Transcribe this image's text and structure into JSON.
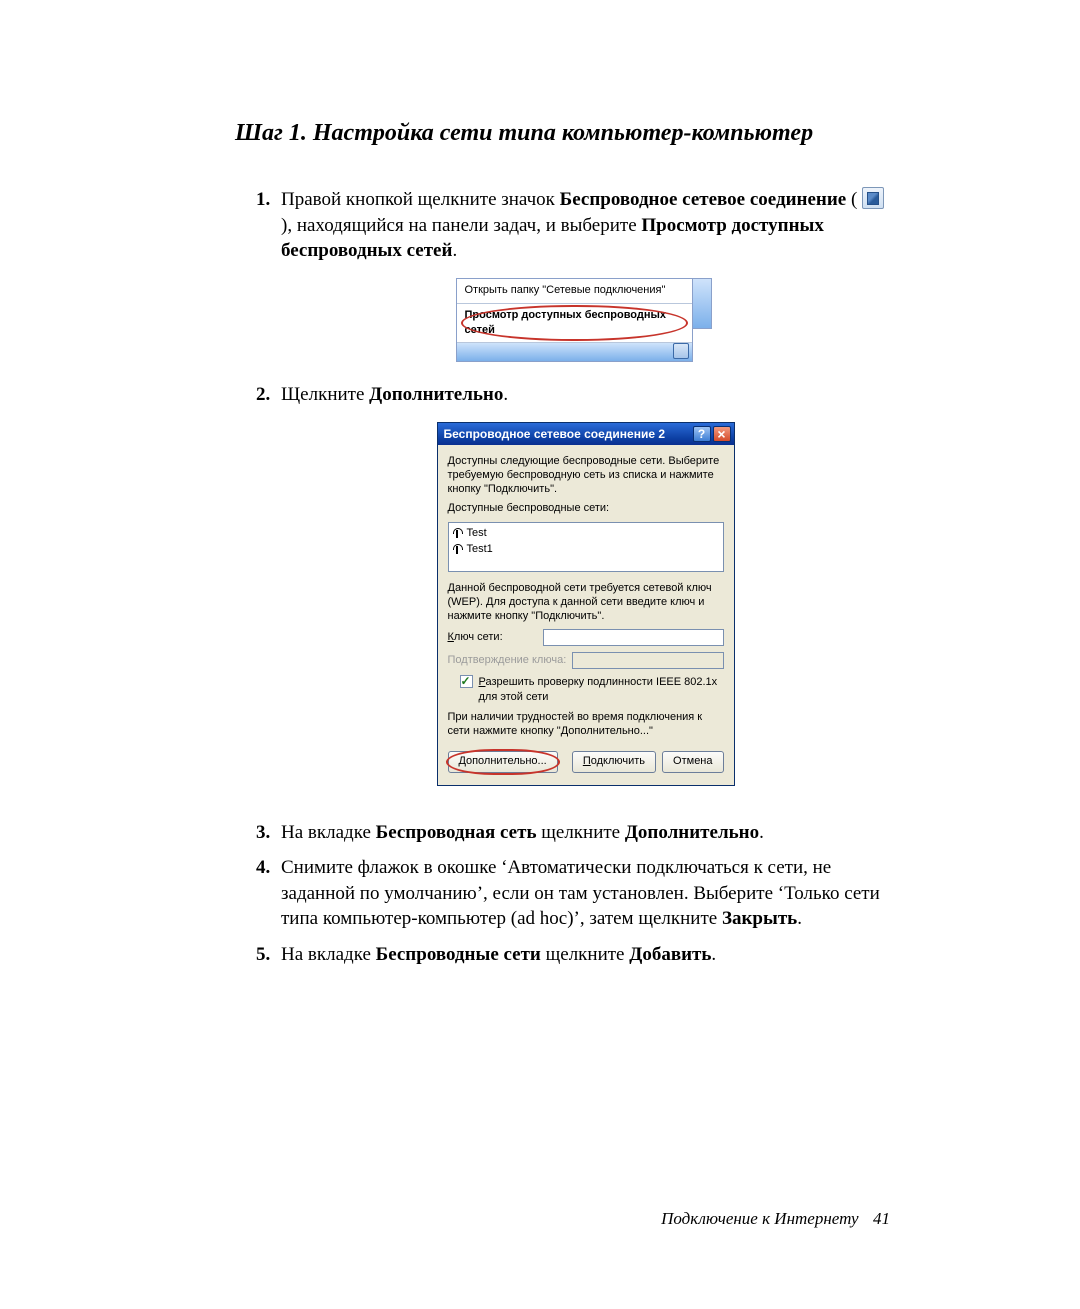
{
  "step_title": "Шаг 1. Настройка сети типа компьютер-компьютер",
  "steps": {
    "s1": {
      "pre": "Правой кнопкой щелкните значок ",
      "b1": "Беспроводное сетевое соединение",
      "mid": " ( ",
      "post_icon": " ), находящийся на панели задач, и выберите ",
      "b2": "Просмотр доступных беспроводных сетей",
      "tail": "."
    },
    "s2": {
      "pre": "Щелкните ",
      "b1": "Дополнительно",
      "tail": "."
    },
    "s3": {
      "pre": "На вкладке ",
      "b1": "Беспроводная сеть",
      "mid": " щелкните ",
      "b2": "Дополнительно",
      "tail": "."
    },
    "s4": {
      "pre": "Снимите флажок в окошке ‘Автоматически подключаться к сети, не заданной по умолчанию’, если он там установлен. Выберите ‘Только сети типа компьютер-компьютер (ad hoc)’, затем щелкните ",
      "b1": "Закрыть",
      "tail": "."
    },
    "s5": {
      "pre": "На вкладке ",
      "b1": "Беспроводные сети",
      "mid": " щелкните ",
      "b2": "Добавить",
      "tail": "."
    }
  },
  "context_menu": {
    "item1": "Открыть папку \"Сетевые подключения\"",
    "item2": "Просмотр доступных беспроводных сетей"
  },
  "dialog": {
    "title": "Беспроводное сетевое соединение 2",
    "intro": "Доступны следующие беспроводные сети. Выберите требуемую беспроводную сеть из списка и нажмите кнопку \"Подключить\".",
    "list_label": "Доступные беспроводные сети:",
    "networks": [
      "Test",
      "Test1"
    ],
    "wep_note": "Данной беспроводной сети требуется сетевой ключ (WEP). Для доступа к данной сети введите ключ и нажмите кнопку \"Подключить\".",
    "key_label_u": "К",
    "key_label_rest": "люч сети:",
    "confirm_label": "Подтверждение ключа:",
    "chk_u": "Р",
    "chk_rest": "азрешить проверку подлинности IEEE 802.1x для этой сети",
    "troubles": "При наличии трудностей во время подключения к сети нажмите кнопку \"Дополнительно...\"",
    "btn_adv_u": "Д",
    "btn_adv_rest": "ополнительно...",
    "btn_conn_u": "П",
    "btn_conn_rest": "одключить",
    "btn_cancel": "Отмена"
  },
  "footer": {
    "text": "Подключение к Интернету",
    "page": "41"
  }
}
